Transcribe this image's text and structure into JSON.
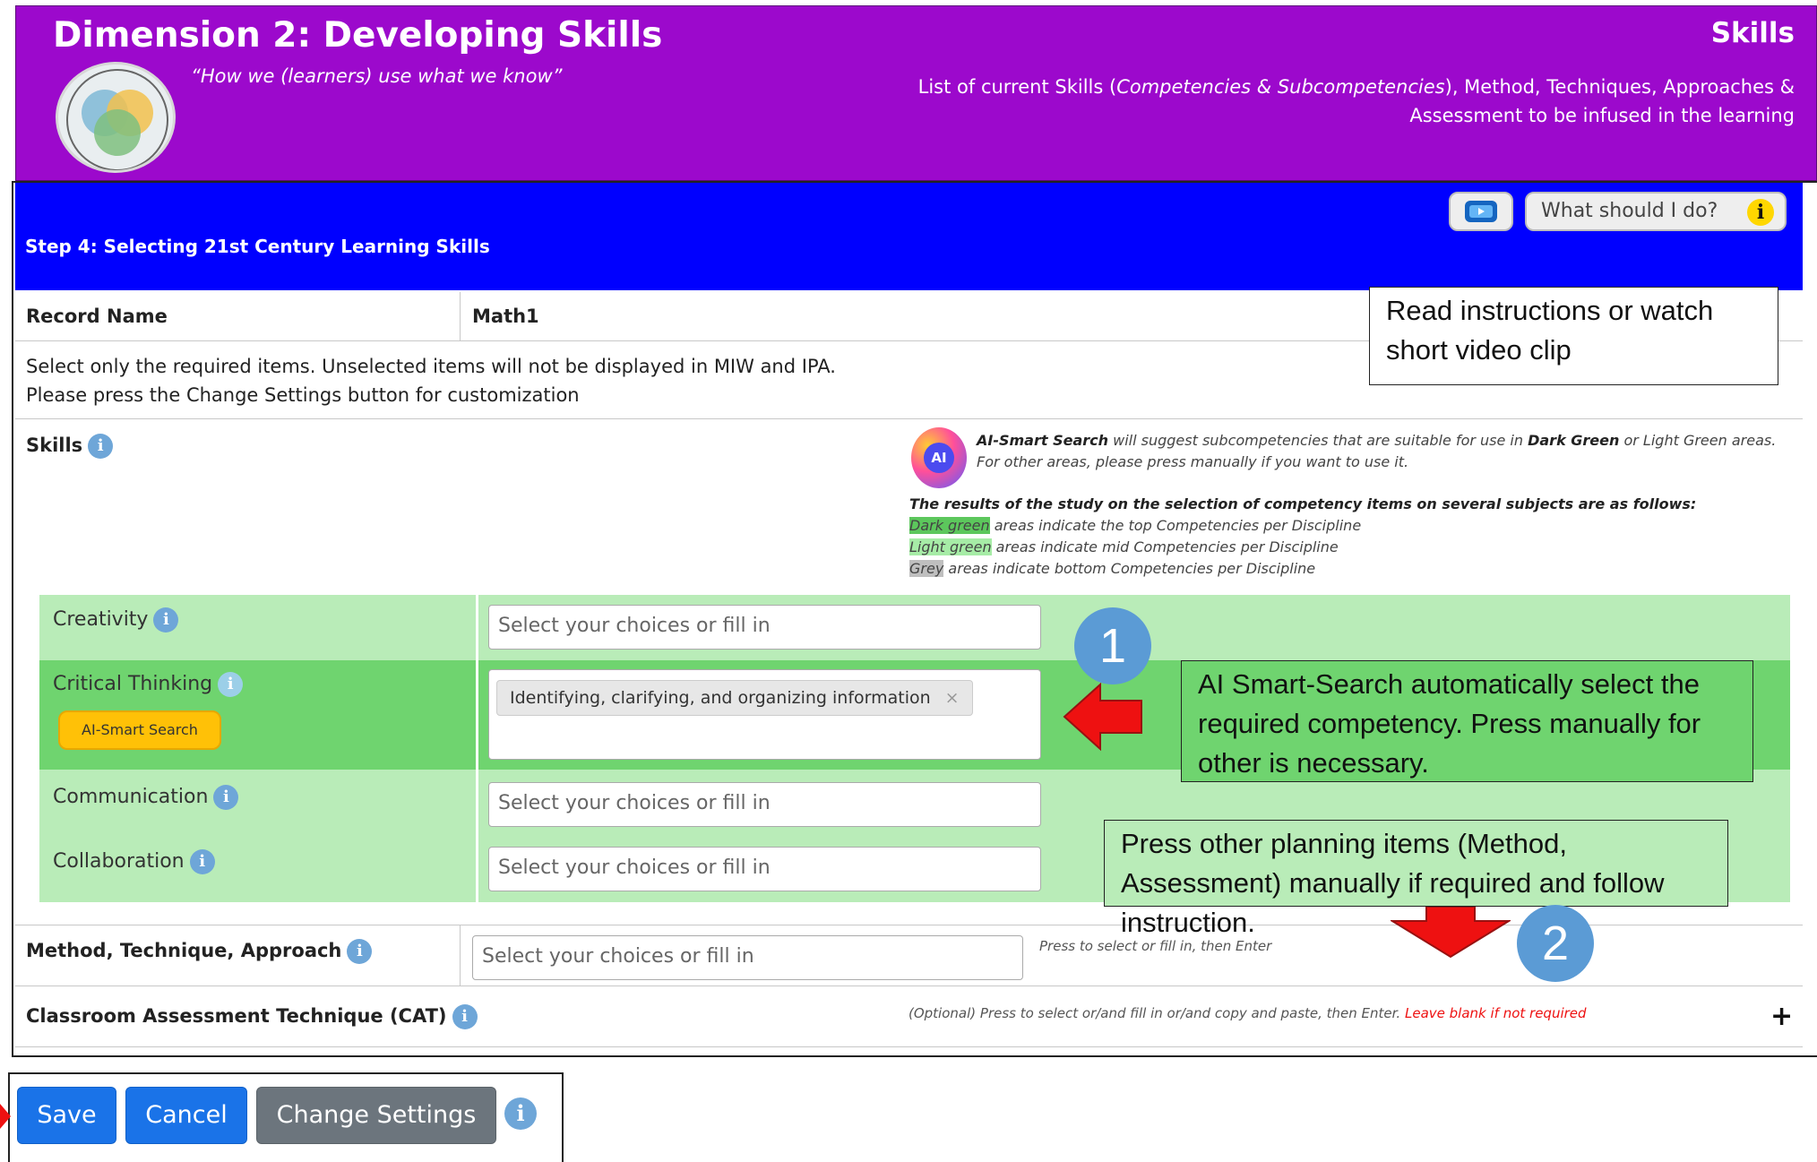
{
  "header": {
    "title": "Dimension 2: Developing Skills",
    "quote": "“How we (learners) use what we know”",
    "right_title": "Skills",
    "desc_part1": "List of current Skills (",
    "desc_italic": "Competencies & Subcompetencies",
    "desc_part2": "), Method, Techniques, Approaches & Assessment to be infused in the learning",
    "logo_icon": "four-dimensional-education-logo"
  },
  "step": {
    "title": "Step 4: Selecting 21st Century Learning Skills",
    "video_icon": "video-icon",
    "help_label": "What should I do?",
    "help_icon": "info-icon"
  },
  "callouts": {
    "instructions": "Read instructions or watch short video clip",
    "ai_select": "AI Smart-Search automatically select the required competency. Press manually for other is necessary.",
    "planning": "Press other planning items (Method, Assessment) manually if required and follow instruction.",
    "step1": "1",
    "step2": "2"
  },
  "record": {
    "label": "Record Name",
    "value": "Math1"
  },
  "instructions": {
    "line1": "Select only the required items. Unselected items will not be displayed in MIW and IPA.",
    "line2": "Please press the Change Settings button for customization"
  },
  "skills": {
    "label": "Skills",
    "ai_badge": "AI",
    "ai_name": "AI-Smart Search",
    "ai_mid": " will suggest subcompetencies that are suitable for use in ",
    "ai_dark": "Dark Green",
    "ai_end": " or Light Green areas. For other areas, please press manually if you want to use it.",
    "study_title": "The results of the study on the selection of competency items on several subjects are as follows:",
    "legend": [
      {
        "key": "Dark green",
        "text": " areas indicate the top Competencies per Discipline"
      },
      {
        "key": "Light green",
        "text": " areas indicate mid Competencies per Discipline"
      },
      {
        "key": "Grey",
        "text": " areas indicate bottom Competencies per Discipline"
      }
    ],
    "items": [
      {
        "name": "Creativity",
        "placeholder": "Select your choices or fill in"
      },
      {
        "name": "Critical Thinking",
        "tag": "Identifying, clarifying, and organizing information",
        "tag_remove": "×",
        "button": "AI-Smart Search"
      },
      {
        "name": "Communication",
        "placeholder": "Select your choices or fill in"
      },
      {
        "name": "Collaboration",
        "placeholder": "Select your choices or fill in"
      }
    ]
  },
  "method": {
    "label": "Method, Technique, Approach",
    "placeholder": "Select your choices or fill in",
    "hint": "Press to select or fill in, then Enter"
  },
  "cat": {
    "label": "Classroom Assessment Technique (CAT)",
    "hint": "(Optional) Press to select or/and fill in or/and copy and paste, then Enter.",
    "hint_red": "Leave blank if not required",
    "expand": "+"
  },
  "buttons": {
    "save": "Save",
    "cancel": "Cancel",
    "change_settings": "Change Settings"
  },
  "colors": {
    "header_purple": "#9c09cc",
    "step_blue": "#0000ff",
    "dark_green": "#6fd46f",
    "light_green": "#b9ecb8",
    "primary": "#1a73e8",
    "ai_button": "#ffc107"
  }
}
